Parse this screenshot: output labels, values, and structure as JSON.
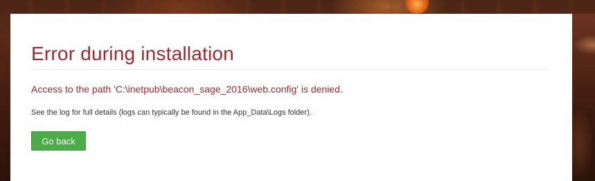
{
  "page": {
    "title": "Error during installation",
    "error_message": "Access to the path 'C:\\inetpub\\beacon_sage_2016\\web.config' is denied.",
    "details": "See the log for full details (logs can typically be found in the App_Data\\Logs folder).",
    "go_back_label": "Go back"
  },
  "colors": {
    "title": "#a4262c",
    "error_text": "#a4262c",
    "button_bg": "#4aad45",
    "button_text": "#ffffff",
    "card_bg": "#ffffff"
  }
}
